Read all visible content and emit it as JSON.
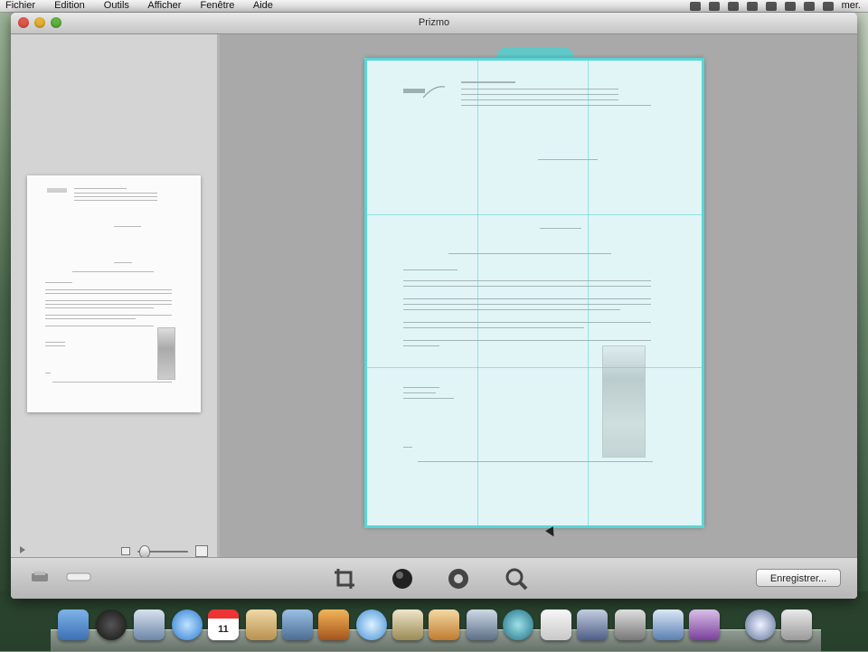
{
  "menubar": {
    "items": [
      "Fichier",
      "Edition",
      "Outils",
      "Afficher",
      "Fenêtre",
      "Aide"
    ],
    "clock": "mer."
  },
  "window": {
    "title": "Prizmo"
  },
  "toolbar": {
    "save_label": "Enregistrer..."
  },
  "dock": {
    "icons": [
      "finder-icon",
      "dashboard-icon",
      "mail-icon",
      "safari-icon",
      "ical-icon",
      "address-book-icon",
      "iphoto-icon",
      "photo-icon",
      "itunes-icon",
      "star-icon",
      "garageband-icon",
      "dashboard-widgets-icon",
      "timemachine-icon",
      "preview-icon",
      "pen-icon",
      "screen-icon",
      "stack-icon",
      "photobooth-icon",
      "moon-icon",
      "trash-icon"
    ],
    "calendar_day": "11"
  },
  "colors": {
    "overlay": "#59d6d6",
    "window_bg": "#cfcfcf",
    "canvas_bg": "#a9a9a9"
  }
}
